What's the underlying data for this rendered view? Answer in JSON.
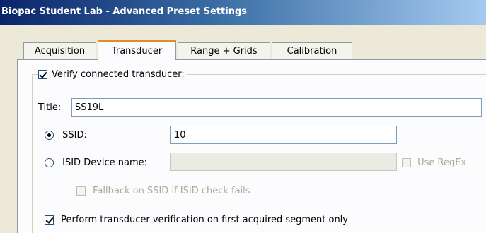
{
  "window": {
    "title": "Biopac Student Lab - Advanced Preset Settings"
  },
  "tabs": [
    {
      "label": "Acquisition",
      "active": false
    },
    {
      "label": "Transducer",
      "active": true
    },
    {
      "label": "Range + Grids",
      "active": false
    },
    {
      "label": "Calibration",
      "active": false
    }
  ],
  "transducer": {
    "verify_label": "Verify connected transducer:",
    "verify_checked": true,
    "title_label": "Title:",
    "title_value": "SS19L",
    "ssid_label": "SSID:",
    "ssid_selected": true,
    "ssid_value": "10",
    "isid_label": "ISID Device name:",
    "isid_selected": false,
    "isid_value": "",
    "use_regex_label": "Use RegEx",
    "use_regex_checked": false,
    "fallback_label": "Fallback on SSID if ISID check fails",
    "fallback_checked": false,
    "first_segment_label": "Perform transducer verification on first acquired segment only",
    "first_segment_checked": true
  }
}
